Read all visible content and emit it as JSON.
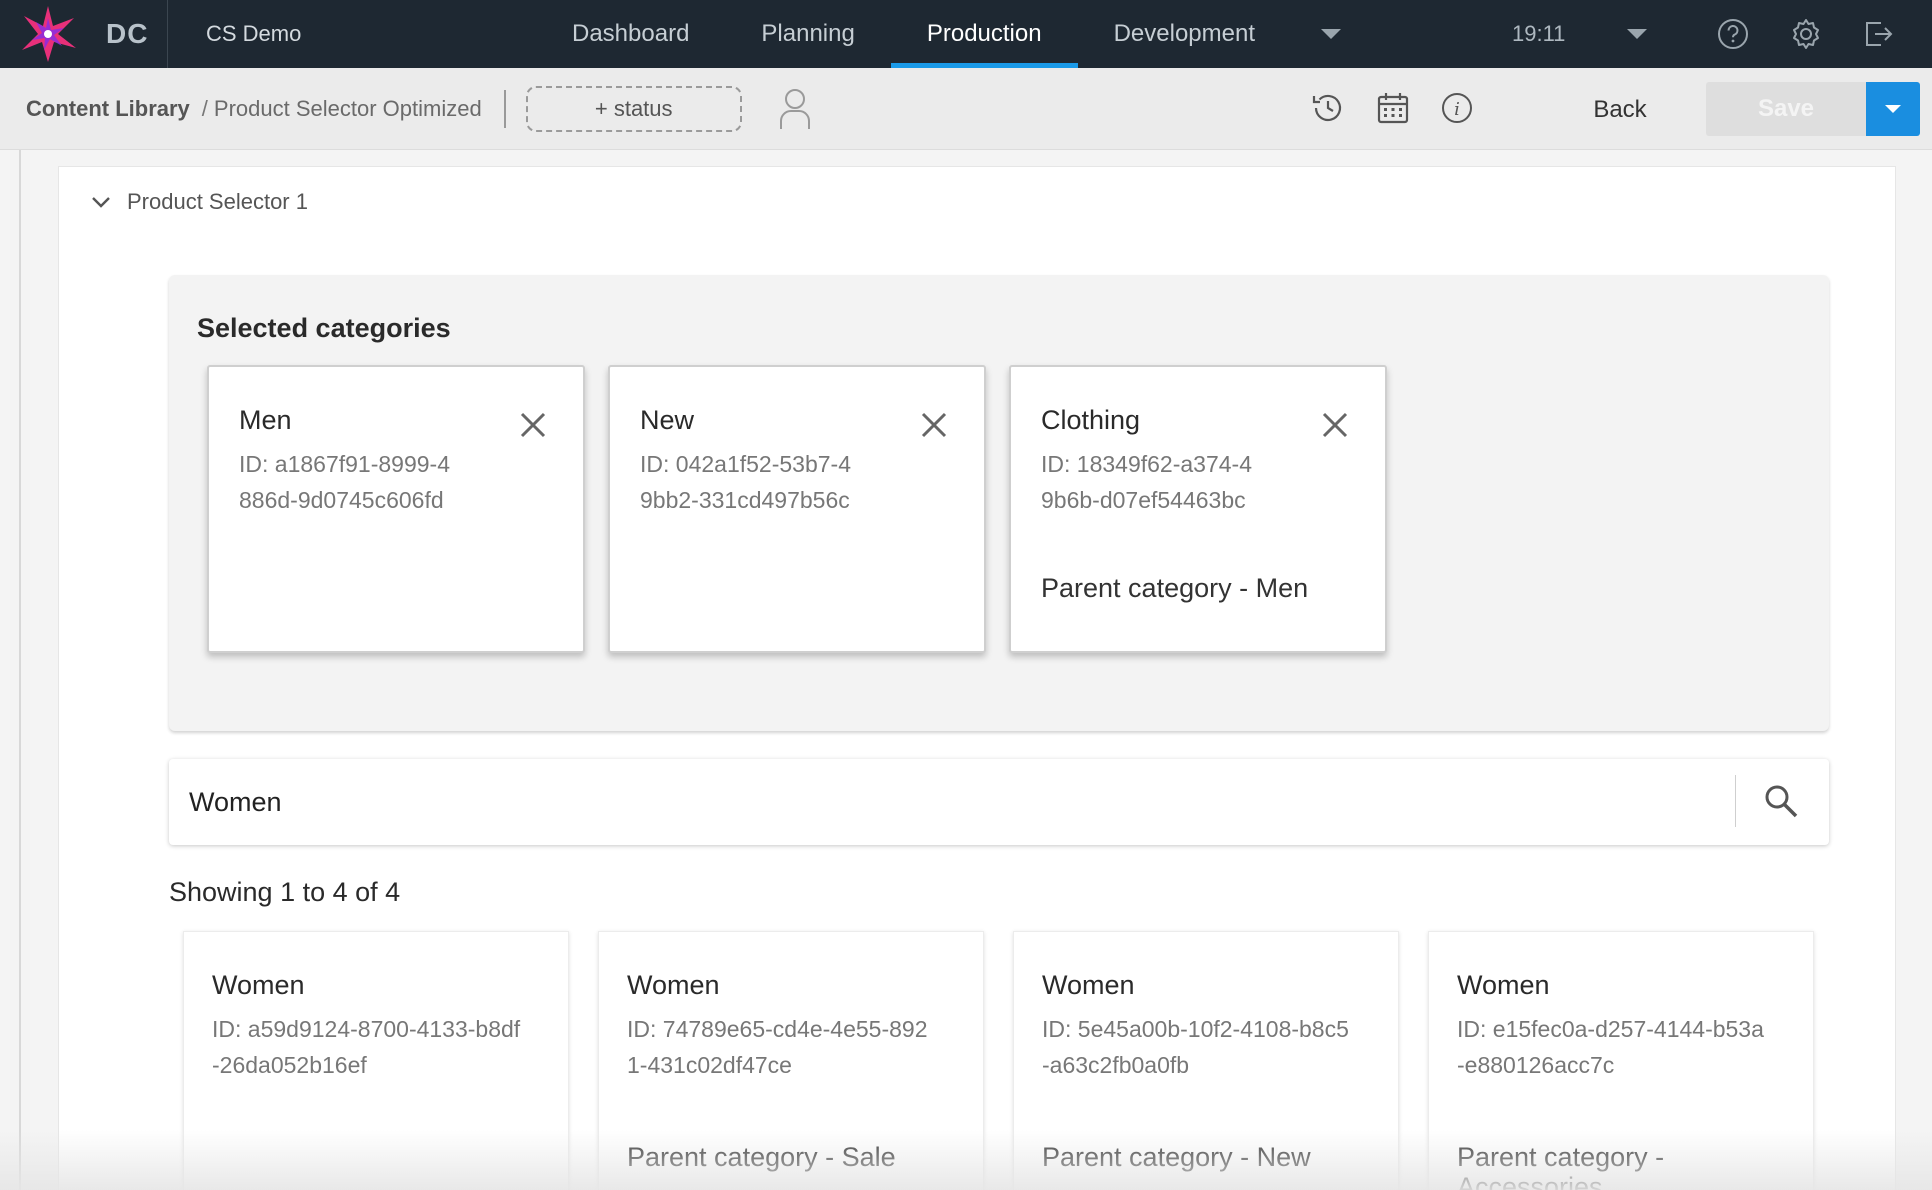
{
  "app": {
    "logo_text": "DC",
    "hub_name": "CS Demo",
    "time": "19:11",
    "accent_color": "#1a9ae8"
  },
  "nav": {
    "tabs": [
      {
        "label": "Dashboard",
        "active": false
      },
      {
        "label": "Planning",
        "active": false
      },
      {
        "label": "Production",
        "active": true
      },
      {
        "label": "Development",
        "active": false
      }
    ]
  },
  "icons": {
    "top": [
      "help-icon",
      "settings-icon",
      "logout-icon"
    ],
    "toolbar": [
      "history-icon",
      "calendar-icon",
      "info-icon"
    ]
  },
  "toolbar": {
    "breadcrumb_root": "Content Library",
    "breadcrumb_sep": "/",
    "breadcrumb_current": "Product Selector Optimized",
    "status_label": "+ status",
    "back_label": "Back",
    "save_label": "Save"
  },
  "section": {
    "title": "Product Selector 1"
  },
  "selected": {
    "title": "Selected categories",
    "items": [
      {
        "name": "Men",
        "id": "ID: a1867f91-8999-4886d-9d0745c606fd",
        "parent": ""
      },
      {
        "name": "New",
        "id": "ID: 042a1f52-53b7-49bb2-331cd497b56c",
        "parent": ""
      },
      {
        "name": "Clothing",
        "id": "ID: 18349f62-a374-49b6b-d07ef54463bc",
        "parent": "Parent category - Men"
      }
    ]
  },
  "search": {
    "value": "Women",
    "placeholder": ""
  },
  "results": {
    "summary": "Showing 1 to 4 of 4",
    "items": [
      {
        "name": "Women",
        "id": "ID: a59d9124-8700-4133-b8df-26da052b16ef",
        "parent": ""
      },
      {
        "name": "Women",
        "id": "ID: 74789e65-cd4e-4e55-8921-431c02df47ce",
        "parent": "Parent category - Sale"
      },
      {
        "name": "Women",
        "id": "ID: 5e45a00b-10f2-4108-b8c5-a63c2fb0a0fb",
        "parent": "Parent category - New"
      },
      {
        "name": "Women",
        "id": "ID: e15fec0a-d257-4144-b53a-e880126acc7c",
        "parent": "Parent category - Accessories"
      }
    ]
  }
}
